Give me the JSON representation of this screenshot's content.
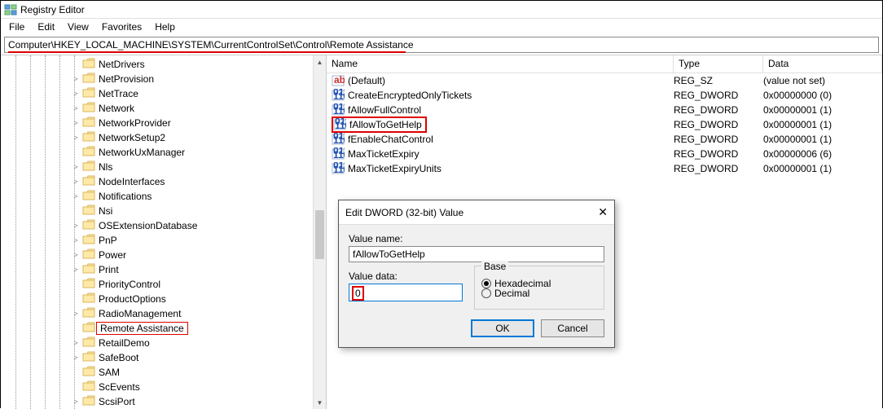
{
  "window": {
    "title": "Registry Editor"
  },
  "menu": [
    "File",
    "Edit",
    "View",
    "Favorites",
    "Help"
  ],
  "address": "Computer\\HKEY_LOCAL_MACHINE\\SYSTEM\\CurrentControlSet\\Control\\Remote Assistance",
  "tree": [
    {
      "label": "NetDrivers",
      "chev": ""
    },
    {
      "label": "NetProvision",
      "chev": ">"
    },
    {
      "label": "NetTrace",
      "chev": ">"
    },
    {
      "label": "Network",
      "chev": ">"
    },
    {
      "label": "NetworkProvider",
      "chev": ">"
    },
    {
      "label": "NetworkSetup2",
      "chev": ">"
    },
    {
      "label": "NetworkUxManager",
      "chev": ""
    },
    {
      "label": "Nls",
      "chev": ">"
    },
    {
      "label": "NodeInterfaces",
      "chev": ">"
    },
    {
      "label": "Notifications",
      "chev": ">"
    },
    {
      "label": "Nsi",
      "chev": ""
    },
    {
      "label": "OSExtensionDatabase",
      "chev": ">"
    },
    {
      "label": "PnP",
      "chev": ">"
    },
    {
      "label": "Power",
      "chev": ">"
    },
    {
      "label": "Print",
      "chev": ">"
    },
    {
      "label": "PriorityControl",
      "chev": ""
    },
    {
      "label": "ProductOptions",
      "chev": ""
    },
    {
      "label": "RadioManagement",
      "chev": ">"
    },
    {
      "label": "Remote Assistance",
      "chev": "",
      "selected": true
    },
    {
      "label": "RetailDemo",
      "chev": ">"
    },
    {
      "label": "SafeBoot",
      "chev": ">"
    },
    {
      "label": "SAM",
      "chev": ""
    },
    {
      "label": "ScEvents",
      "chev": ""
    },
    {
      "label": "ScsiPort",
      "chev": ">"
    }
  ],
  "columns": {
    "name": "Name",
    "type": "Type",
    "data": "Data"
  },
  "values": [
    {
      "icon": "ab",
      "name": "(Default)",
      "type": "REG_SZ",
      "data": "(value not set)"
    },
    {
      "icon": "bin",
      "name": "CreateEncryptedOnlyTickets",
      "type": "REG_DWORD",
      "data": "0x00000000 (0)"
    },
    {
      "icon": "bin",
      "name": "fAllowFullControl",
      "type": "REG_DWORD",
      "data": "0x00000001 (1)"
    },
    {
      "icon": "bin",
      "name": "fAllowToGetHelp",
      "type": "REG_DWORD",
      "data": "0x00000001 (1)",
      "hl": true
    },
    {
      "icon": "bin",
      "name": "fEnableChatControl",
      "type": "REG_DWORD",
      "data": "0x00000001 (1)"
    },
    {
      "icon": "bin",
      "name": "MaxTicketExpiry",
      "type": "REG_DWORD",
      "data": "0x00000006 (6)"
    },
    {
      "icon": "bin",
      "name": "MaxTicketExpiryUnits",
      "type": "REG_DWORD",
      "data": "0x00000001 (1)"
    }
  ],
  "dialog": {
    "title": "Edit DWORD (32-bit) Value",
    "value_name_label": "Value name:",
    "value_name": "fAllowToGetHelp",
    "value_data_label": "Value data:",
    "value_data": "0",
    "base_label": "Base",
    "radio_hex": "Hexadecimal",
    "radio_dec": "Decimal",
    "ok": "OK",
    "cancel": "Cancel"
  }
}
